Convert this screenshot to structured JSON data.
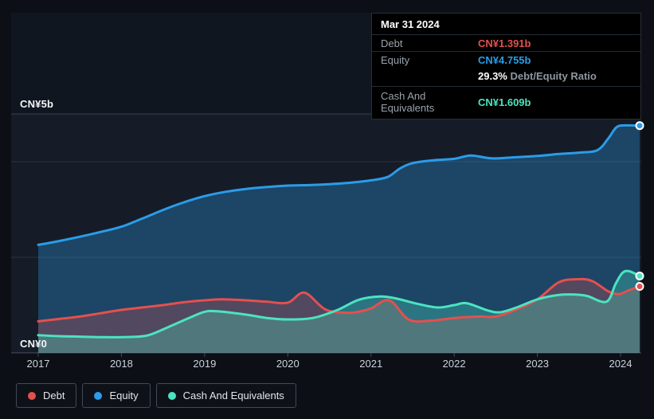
{
  "tooltip": {
    "date": "Mar 31 2024",
    "debt_label": "Debt",
    "debt_value": "CN¥1.391b",
    "equity_label": "Equity",
    "equity_value": "CN¥4.755b",
    "ratio_value": "29.3%",
    "ratio_label": "Debt/Equity Ratio",
    "cash_label": "Cash And Equivalents",
    "cash_value": "CN¥1.609b"
  },
  "legend": {
    "items": [
      {
        "label": "Debt",
        "color": "#e4504e"
      },
      {
        "label": "Equity",
        "color": "#2b9ce8"
      },
      {
        "label": "Cash And Equivalents",
        "color": "#4be4c0"
      }
    ]
  },
  "colors": {
    "background": "#0c1016",
    "plot_background_upper": "#10161f",
    "plot_background": "#151c28",
    "gridline": "#9aabc0",
    "axis_text": "#ccd2da",
    "tooltip_background": "#000000",
    "debt": "#e4504e",
    "equity": "#2b9ce8",
    "cash": "#4be4c0"
  },
  "chart_data": {
    "type": "area",
    "title": "Debt to Equity history (CN¥, billions)",
    "x_axis": {
      "tick_labels": [
        "2017",
        "2018",
        "2019",
        "2020",
        "2021",
        "2022",
        "2023",
        "2024"
      ],
      "ticks": [
        2017,
        2018,
        2019,
        2020,
        2021,
        2022,
        2023,
        2024
      ],
      "range": [
        2016.67,
        2024.25
      ]
    },
    "y_axis": {
      "min": 0,
      "max": 5,
      "unit": "CN¥ billions",
      "min_label": "CN¥0",
      "max_label": "CN¥5b",
      "gridline_values": [
        5,
        4,
        2,
        0
      ]
    },
    "legend_position": "bottom-left",
    "series": [
      {
        "name": "Equity",
        "color": "#2b9ce8",
        "fill_opacity": 0.33,
        "points": [
          [
            2017.0,
            2.26
          ],
          [
            2017.25,
            2.34
          ],
          [
            2017.5,
            2.43
          ],
          [
            2017.75,
            2.53
          ],
          [
            2018.0,
            2.64
          ],
          [
            2018.25,
            2.81
          ],
          [
            2018.5,
            2.99
          ],
          [
            2018.75,
            3.15
          ],
          [
            2019.0,
            3.28
          ],
          [
            2019.25,
            3.37
          ],
          [
            2019.5,
            3.43
          ],
          [
            2019.75,
            3.47
          ],
          [
            2020.0,
            3.5
          ],
          [
            2020.25,
            3.51
          ],
          [
            2020.5,
            3.53
          ],
          [
            2020.75,
            3.56
          ],
          [
            2021.0,
            3.61
          ],
          [
            2021.2,
            3.68
          ],
          [
            2021.35,
            3.86
          ],
          [
            2021.5,
            3.97
          ],
          [
            2021.75,
            4.03
          ],
          [
            2022.0,
            4.06
          ],
          [
            2022.2,
            4.13
          ],
          [
            2022.45,
            4.07
          ],
          [
            2022.7,
            4.09
          ],
          [
            2023.0,
            4.12
          ],
          [
            2023.25,
            4.16
          ],
          [
            2023.5,
            4.19
          ],
          [
            2023.72,
            4.24
          ],
          [
            2023.85,
            4.48
          ],
          [
            2023.95,
            4.72
          ],
          [
            2024.05,
            4.76
          ],
          [
            2024.23,
            4.755
          ]
        ]
      },
      {
        "name": "Debt",
        "color": "#e4504e",
        "fill_opacity": 0.27,
        "points": [
          [
            2017.0,
            0.66
          ],
          [
            2017.25,
            0.71
          ],
          [
            2017.5,
            0.76
          ],
          [
            2017.75,
            0.83
          ],
          [
            2018.0,
            0.9
          ],
          [
            2018.25,
            0.95
          ],
          [
            2018.5,
            1.0
          ],
          [
            2018.75,
            1.06
          ],
          [
            2019.0,
            1.1
          ],
          [
            2019.2,
            1.12
          ],
          [
            2019.5,
            1.1
          ],
          [
            2019.75,
            1.07
          ],
          [
            2020.0,
            1.05
          ],
          [
            2020.2,
            1.26
          ],
          [
            2020.45,
            0.91
          ],
          [
            2020.7,
            0.84
          ],
          [
            2020.85,
            0.86
          ],
          [
            2021.0,
            0.93
          ],
          [
            2021.22,
            1.1
          ],
          [
            2021.45,
            0.7
          ],
          [
            2021.7,
            0.67
          ],
          [
            2022.0,
            0.73
          ],
          [
            2022.3,
            0.76
          ],
          [
            2022.5,
            0.76
          ],
          [
            2022.75,
            0.91
          ],
          [
            2023.0,
            1.12
          ],
          [
            2023.25,
            1.47
          ],
          [
            2023.45,
            1.54
          ],
          [
            2023.65,
            1.51
          ],
          [
            2023.85,
            1.29
          ],
          [
            2023.98,
            1.23
          ],
          [
            2024.1,
            1.31
          ],
          [
            2024.23,
            1.391
          ]
        ]
      },
      {
        "name": "Cash And Equivalents",
        "color": "#4be4c0",
        "fill_opacity": 0.3,
        "points": [
          [
            2017.0,
            0.37
          ],
          [
            2017.25,
            0.35
          ],
          [
            2017.5,
            0.34
          ],
          [
            2017.75,
            0.33
          ],
          [
            2018.0,
            0.33
          ],
          [
            2018.3,
            0.36
          ],
          [
            2018.55,
            0.53
          ],
          [
            2018.8,
            0.72
          ],
          [
            2019.0,
            0.86
          ],
          [
            2019.15,
            0.87
          ],
          [
            2019.5,
            0.8
          ],
          [
            2019.75,
            0.73
          ],
          [
            2020.0,
            0.7
          ],
          [
            2020.3,
            0.73
          ],
          [
            2020.6,
            0.9
          ],
          [
            2020.85,
            1.11
          ],
          [
            2021.1,
            1.18
          ],
          [
            2021.3,
            1.14
          ],
          [
            2021.55,
            1.03
          ],
          [
            2021.8,
            0.95
          ],
          [
            2022.0,
            1.0
          ],
          [
            2022.15,
            1.04
          ],
          [
            2022.4,
            0.89
          ],
          [
            2022.55,
            0.85
          ],
          [
            2022.75,
            0.95
          ],
          [
            2023.0,
            1.12
          ],
          [
            2023.25,
            1.21
          ],
          [
            2023.45,
            1.22
          ],
          [
            2023.6,
            1.19
          ],
          [
            2023.83,
            1.07
          ],
          [
            2023.94,
            1.44
          ],
          [
            2024.02,
            1.67
          ],
          [
            2024.1,
            1.71
          ],
          [
            2024.23,
            1.609
          ]
        ]
      }
    ],
    "end_markers": true
  }
}
